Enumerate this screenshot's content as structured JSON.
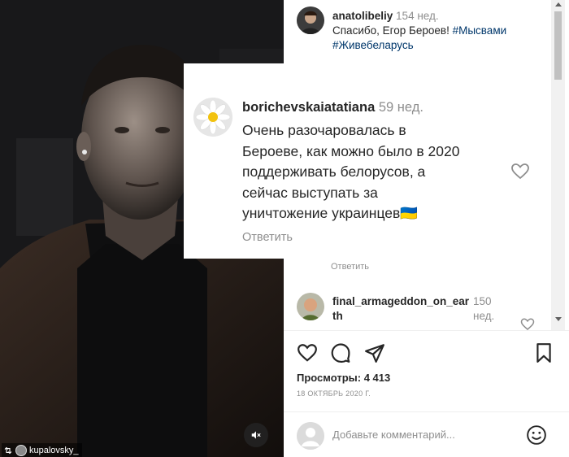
{
  "video": {
    "repost_user": "kupalovsky_",
    "mute_icon": "speaker-muted-icon"
  },
  "comments": [
    {
      "username": "anatolibeliy",
      "time": "154 нед.",
      "text": "Спасибо, Егор Бероев! ",
      "tags": [
        "#Мысвами",
        "#Живебеларусь"
      ]
    },
    {
      "reply_label": "Ответить"
    },
    {
      "username_part1": "final_armageddon_on_ear",
      "username_part2": "th",
      "time_part1": "150",
      "time_part2": "нед."
    }
  ],
  "zoomed_comment": {
    "username": "borichevskaiatatiana",
    "time": "59 нед.",
    "lines": [
      "Очень разочаровалась в",
      "Бероеве, как можно было в 2020",
      "поддерживать белорусов, а",
      "сейчас выступать за",
      "уничтожение украинцев🇺🇦"
    ],
    "reply_label": "Ответить"
  },
  "post": {
    "views_label": "Просмотры: 4 413",
    "date": "18 ОКТЯБРЬ 2020 Г."
  },
  "add_comment": {
    "placeholder": "Добавьте комментарий..."
  },
  "colors": {
    "link": "#00376b",
    "muted": "#8e8e8e",
    "text": "#262626"
  }
}
